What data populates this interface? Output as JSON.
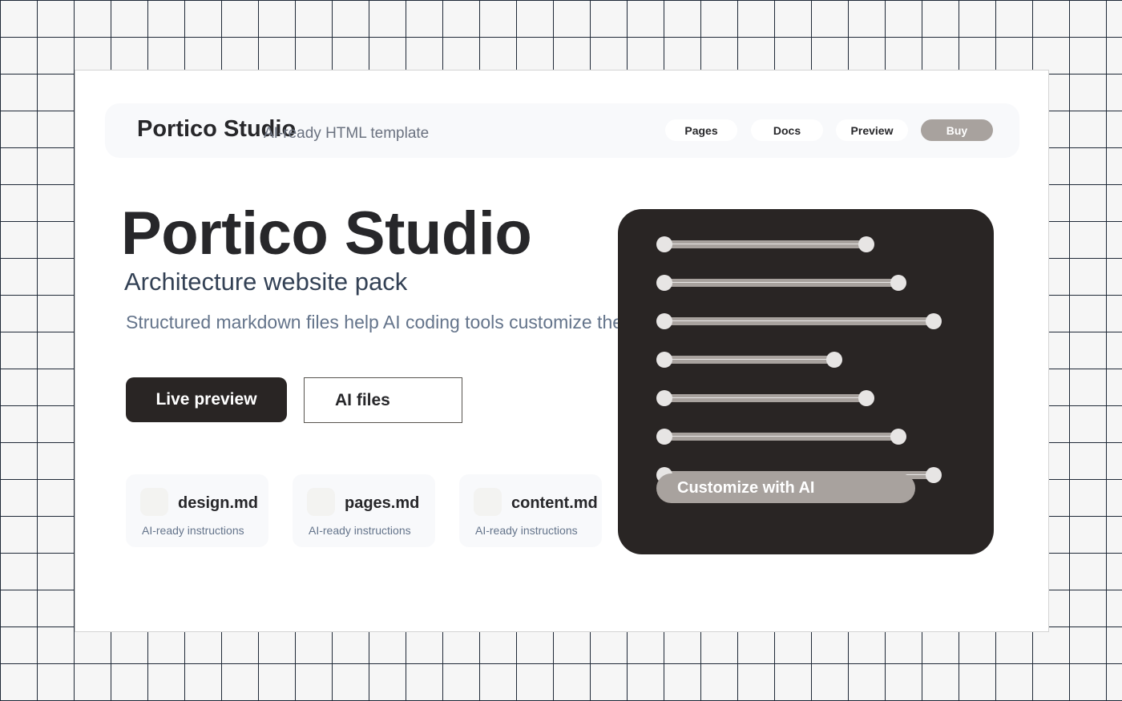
{
  "header": {
    "brand": "Portico Studio",
    "tagline": "AI-ready HTML template",
    "nav": {
      "pages": "Pages",
      "docs": "Docs",
      "preview": "Preview",
      "buy": "Buy"
    }
  },
  "hero": {
    "title": "Portico Studio",
    "subtitle": "Architecture website pack",
    "description": "Structured markdown files help AI coding tools customize the template.",
    "primary_button": "Live preview",
    "secondary_button": "AI files"
  },
  "files": [
    {
      "name": "design.md",
      "note": "AI-ready instructions"
    },
    {
      "name": "pages.md",
      "note": "AI-ready instructions"
    },
    {
      "name": "content.md",
      "note": "AI-ready instructions"
    }
  ],
  "panel": {
    "sliders": [
      0.63,
      0.73,
      0.84,
      0.53,
      0.63,
      0.73,
      0.84
    ],
    "customize_button": "Customize with AI"
  },
  "colors": {
    "ink": "#27272a",
    "dark_panel": "#292524",
    "accent": "#a8a29e",
    "surface": "#f8f9fb",
    "muted_text": "#64748b"
  }
}
